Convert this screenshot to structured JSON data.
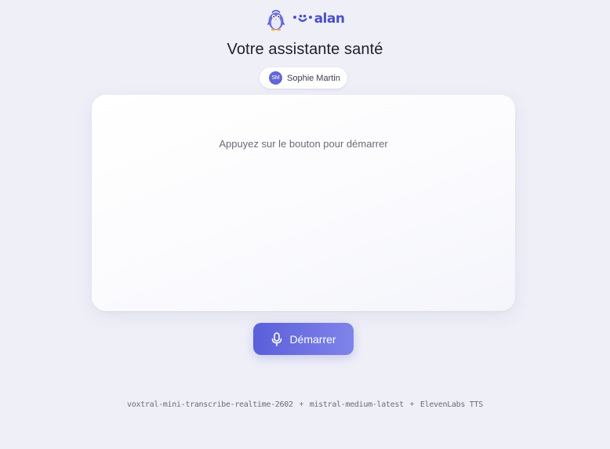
{
  "header": {
    "mascot_icon": "penguin-mascot-icon",
    "logo_mark_icon": "alan-logo-mark-icon",
    "logo_text": "alan",
    "brand_color": "#4c50c8"
  },
  "title": "Votre assistante santé",
  "user": {
    "initials": "SM",
    "name": "Sophie Martin",
    "avatar_color": "#6366d4"
  },
  "conversation": {
    "prompt": "Appuyez sur le bouton pour démarrer"
  },
  "start_button": {
    "icon": "microphone-icon",
    "label": "Démarrer",
    "color_start": "#5b5fd9",
    "color_end": "#7f84ea"
  },
  "footer": {
    "stt_model": "voxtral-mini-transcribe-realtime-2602",
    "llm_model": "mistral-medium-latest",
    "tts_provider": "ElevenLabs TTS",
    "separator": "+"
  }
}
